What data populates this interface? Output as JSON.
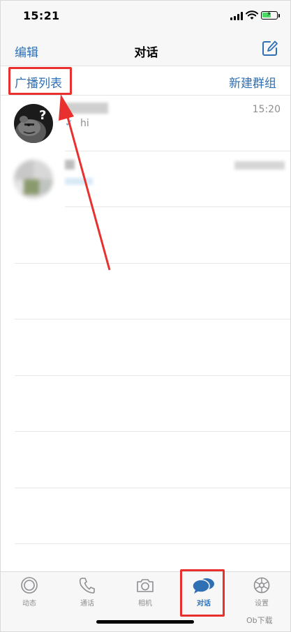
{
  "status": {
    "time": "15:21"
  },
  "nav": {
    "edit_label": "编辑",
    "title": "对话"
  },
  "sub": {
    "broadcast_label": "广播列表",
    "new_group_label": "新建群组"
  },
  "chats": [
    {
      "time": "15:20",
      "preview": "hi",
      "read": true
    },
    {
      "time": "",
      "preview": ""
    }
  ],
  "tabs": [
    {
      "label": "动态",
      "icon": "status-icon",
      "active": false
    },
    {
      "label": "通话",
      "icon": "phone-icon",
      "active": false
    },
    {
      "label": "相机",
      "icon": "camera-icon",
      "active": false
    },
    {
      "label": "对话",
      "icon": "chats-icon",
      "active": true
    },
    {
      "label": "设置",
      "icon": "gear-icon",
      "active": false
    }
  ],
  "watermark": "Ob下载",
  "colors": {
    "accent": "#2f6fb3",
    "annotation": "#e8312f",
    "battery": "#4cd964"
  }
}
